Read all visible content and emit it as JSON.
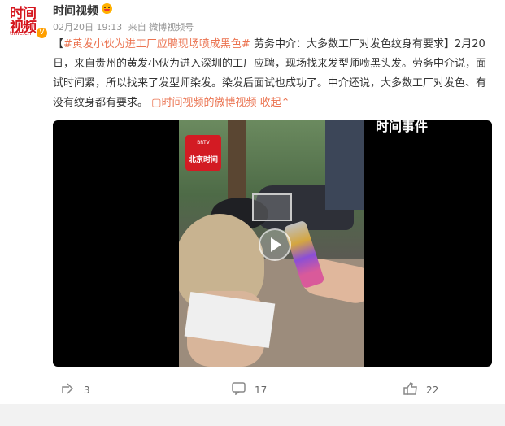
{
  "header": {
    "avatar": {
      "line1": "时间",
      "line2": "视频",
      "line3": "time.cn"
    },
    "verified_icon": "verified-v-icon",
    "username": "时间视频",
    "emoji_icon": "smiley-face-emoji-icon",
    "date": "02月20日 19:13",
    "source": "来自 微博视频号"
  },
  "post": {
    "topic": "#黄发小伙为进工厂应聘现场喷成黑色#",
    "text": "劳务中介：大多数工厂对发色纹身有要求】2月20日，来自贵州的黄发小伙为进入深圳的工厂应聘，现场找来发型师喷黑头发。劳务中介说，面试时间紧，所以找来了发型师染发。染发后面试也成功了。中介还说，大多数工厂对发色、有没有纹身都有要求。",
    "open_bracket": "【",
    "video_link": "时间视频的微博视频",
    "collapse": "收起"
  },
  "video": {
    "logo_top": "BRTV",
    "logo_name": "北京时间",
    "watermark": "时间事件"
  },
  "actions": {
    "share_count": "3",
    "comment_count": "17",
    "like_count": "22"
  },
  "colors": {
    "accent": "#eb7350",
    "brand_red": "#d31b23"
  }
}
